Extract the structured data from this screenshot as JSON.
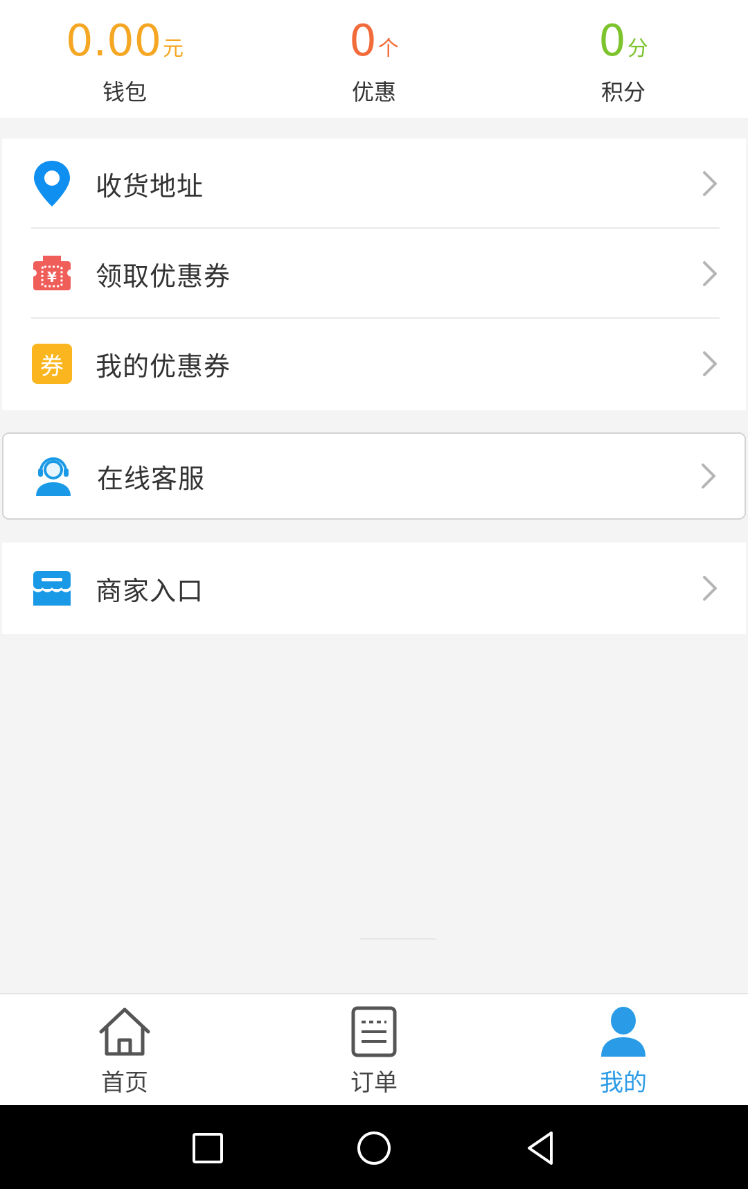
{
  "stats": [
    {
      "value": "0.00",
      "unit": "元",
      "label": "钱包",
      "color": "#f5a623"
    },
    {
      "value": "0",
      "unit": "个",
      "label": "优惠",
      "color": "#f26b3a"
    },
    {
      "value": "0",
      "unit": "分",
      "label": "积分",
      "color": "#7cc32c"
    }
  ],
  "menu": {
    "address": "收货地址",
    "get_coupon": "领取优惠券",
    "my_coupon": "我的优惠券",
    "my_coupon_badge": "券",
    "online_service": "在线客服",
    "merchant_entry": "商家入口"
  },
  "bottom_nav": {
    "home": "首页",
    "orders": "订单",
    "mine": "我的",
    "active": "mine",
    "active_color": "#2a9be6"
  },
  "icons": {
    "address": "location-pin-icon",
    "get_coupon": "coupon-ticket-icon",
    "my_coupon": "coupon-badge-icon",
    "online_service": "customer-service-icon",
    "merchant_entry": "storefront-icon",
    "chevron": "chevron-right-icon"
  }
}
